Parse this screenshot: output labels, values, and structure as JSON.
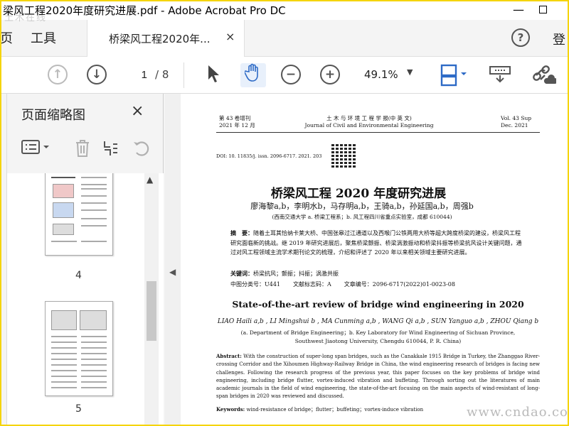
{
  "window": {
    "title": "梁风工程2020年度研究进展.pdf - Adobe Acrobat Pro DC",
    "minimize": "—"
  },
  "tabs": {
    "home": "页",
    "tools": "工具",
    "document": "桥梁风工程2020年...",
    "close": "×",
    "help": "?",
    "login": "登"
  },
  "toolbar": {
    "current_page": "1",
    "total_pages": "/ 8",
    "zoom": "49.1%",
    "icons": [
      "arrow-up-circle-icon",
      "arrow-down-circle-icon",
      "pointer-icon",
      "hand-icon",
      "zoom-out-icon",
      "zoom-in-icon",
      "page-fit-icon",
      "scroll-mode-icon",
      "share-link-icon"
    ]
  },
  "thumbnails_panel": {
    "title": "页面缩略图",
    "close": "×",
    "pages": [
      "4",
      "5"
    ]
  },
  "document": {
    "header_left": [
      "第 43 卷增刊",
      "2021 年 12 月"
    ],
    "header_center": [
      "土 木 与 环 境 工 程 学 报(中 英 文)",
      "Journal of Civil and Environmental Engineering"
    ],
    "header_right": [
      "Vol. 43 Sup",
      "Dec.  2021"
    ],
    "doi": "DOI: 10. 11835/j. issn. 2096-6717. 2021. 203",
    "zh_title": "桥梁风工程 2020 年度研究进展",
    "zh_authors": "廖海黎a,b，李明水b，马存明a,b，王骑a,b，孙延国a,b，周强b",
    "zh_affiliation": "(西南交通大学 a. 桥梁工程系；b. 风工程四川省重点实验室，成都 610044)",
    "zh_abstract_label": "摘　要：",
    "zh_abstract": "随着土耳其恰纳卡莱大桥、中国张皋过江通道以及西堠门公铁两用大桥等超大跨度桥梁的建设，桥梁风工程研究面临新的挑战。继 2019 年研究进展后，聚焦桥梁颤振、桥梁涡激振动和桥梁抖振等桥梁抗风设计关键问题，通过对风工程领域主流学术期刊论文的梳理，介绍和评述了 2020 年以来相关领域主要研究进展。",
    "zh_keywords_label": "关键词：",
    "zh_keywords": "桥梁抗风；颤振；抖振；涡激共振",
    "zh_class": [
      "中图分类号：U441",
      "文献标志码：A",
      "文章编号：2096-6717(2022)01-0023-08"
    ],
    "en_title": "State-of-the-art review of bridge wind engineering in 2020",
    "en_authors": "LIAO Haili a,b , LI Mingshui b , MA Cunming a,b , WANG Qi a,b , SUN Yanguo a,b , ZHOU Qiang b",
    "en_affiliation": [
      "(a. Department of Bridge Engineering；b. Key Laboratory for Wind Engineering of Sichuan Province,",
      "Southwest Jiaotong University, Chengdu 610044, P. R. China)"
    ],
    "en_abstract_label": "Abstract:",
    "en_abstract": "With the construction of super-long span bridges, such as the Canakkale 1915 Bridge in Turkey, the Zhanggao River-crossing Corridor and the Xihoumen Highway-Railway Bridge in China, the wind engineering research of bridges is facing new challenges. Following the research progress of the previous year, this paper focuses on the key problems of bridge wind engineering, including bridge flutter, vortex-induced vibration and buffeting. Through sorting out the literatures of main academic journals in the field of wind engineering, the state-of-the-art focusing on the main aspects of wind-resistant of long-span bridges in 2020 was reviewed and discussed.",
    "en_keywords_label": "Keywords:",
    "en_keywords": "wind-resistance of bridge；flutter；buffeting；vortex-induce vibration"
  },
  "watermarks": {
    "top_left": "土木在线",
    "bottom_right": "www.cndao.com"
  }
}
